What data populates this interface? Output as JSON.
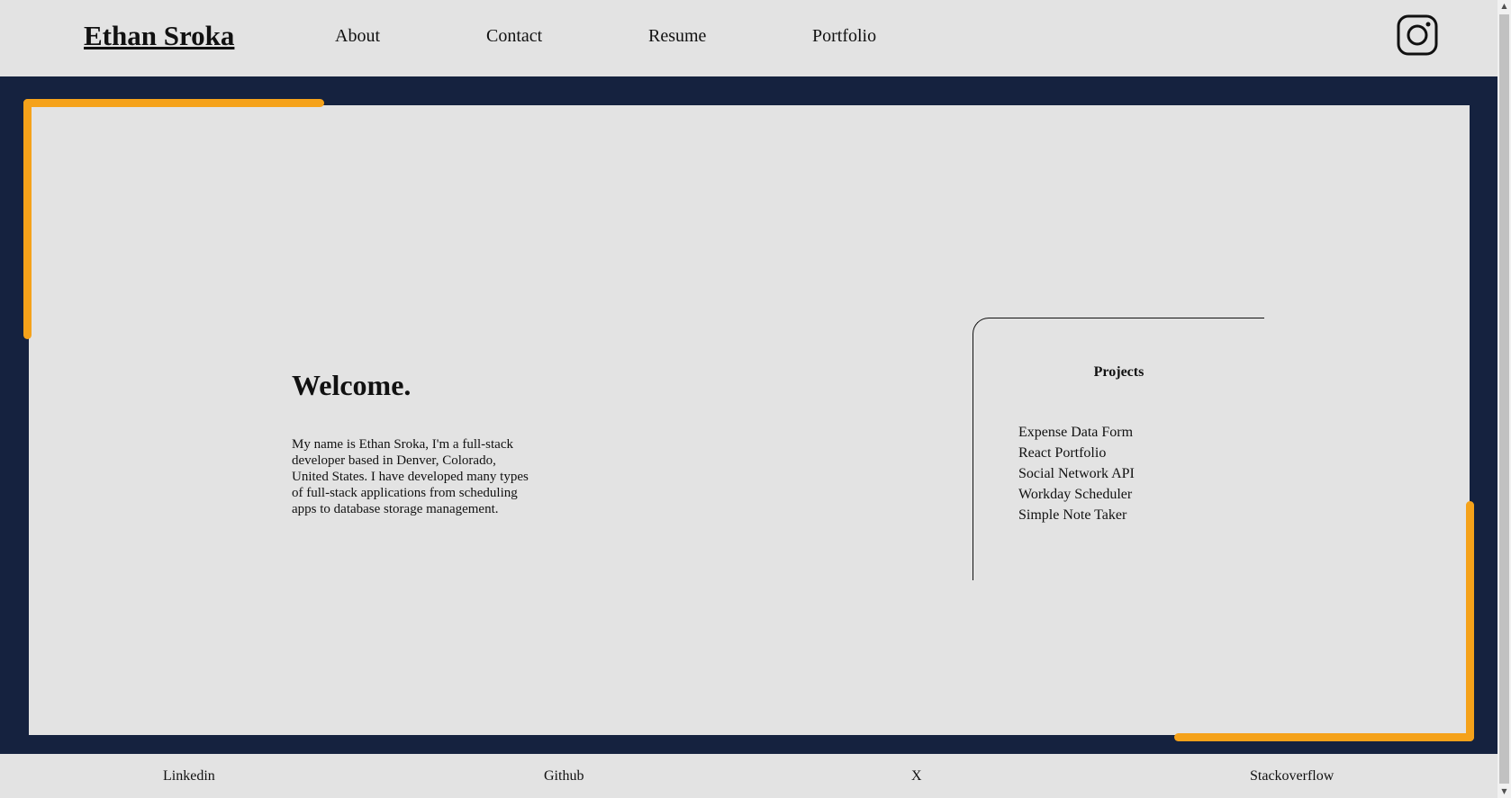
{
  "header": {
    "brand": "Ethan Sroka",
    "nav": [
      {
        "label": "About"
      },
      {
        "label": "Contact"
      },
      {
        "label": "Resume"
      },
      {
        "label": "Portfolio"
      }
    ],
    "social_icon": "instagram-icon"
  },
  "main": {
    "welcome": {
      "title": "Welcome.",
      "text": "My name is Ethan Sroka, I'm a full-stack developer based in Denver, Colorado, United States. I have developed many types of full-stack applications from scheduling apps to database storage management."
    },
    "projects": {
      "title": "Projects",
      "items": [
        "Expense Data Form",
        "React Portfolio",
        "Social Network API",
        "Workday Scheduler",
        "Simple Note Taker"
      ]
    }
  },
  "footer": {
    "links": [
      "Linkedin",
      "Github",
      "X",
      "Stackoverflow"
    ]
  },
  "colors": {
    "background": "#e3e3e3",
    "frame": "#15223f",
    "accent": "#f5a21a"
  },
  "scrollbar": {
    "up_arrow": "▲",
    "down_arrow": "▼"
  }
}
